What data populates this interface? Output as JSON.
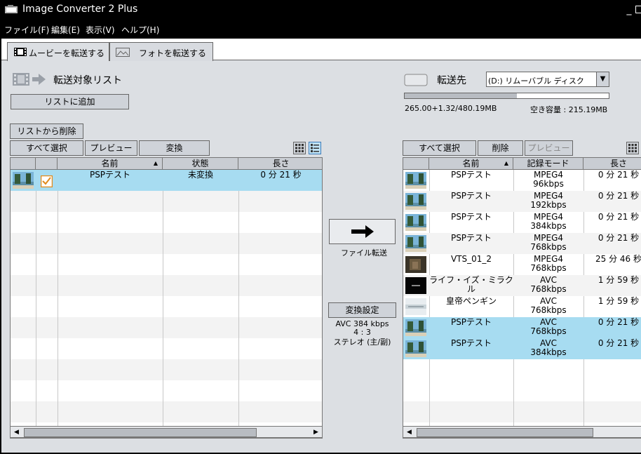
{
  "window": {
    "title": "Image Converter 2 Plus",
    "minimize": "_"
  },
  "menu": [
    "ファイル(F)",
    "編集(E)",
    "表示(V)",
    "ヘルプ(H)"
  ],
  "tabs": {
    "movie": "ムービーを転送する",
    "photo": "フォトを転送する"
  },
  "left": {
    "heading": "転送対象リスト",
    "add_button": "リストに追加",
    "remove_button": "リストから削除",
    "select_all_button": "すべて選択",
    "preview_button": "プレビュー",
    "convert_button": "変換",
    "columns": {
      "name": "名前",
      "status": "状態",
      "length": "長さ"
    },
    "rows": [
      {
        "name": "PSPテスト",
        "status": "未変換",
        "length": "0 分 21 秒"
      }
    ]
  },
  "middle": {
    "transfer_label": "ファイル転送",
    "settings_button": "変換設定",
    "info": [
      "AVC 384 kbps",
      "4 : 3",
      "ステレオ (主/副)"
    ]
  },
  "right": {
    "dest_label": "転送先",
    "dest_value": "(D:) リムーバブル ディスク",
    "usage_text": "265.00+1.32/480.19MB",
    "free_text": "空き容量 : 215.19MB",
    "usage_fraction": 0.55,
    "select_all_button": "すべて選択",
    "delete_button": "削除",
    "preview_button": "プレビュー",
    "columns": {
      "name": "名前",
      "mode": "記録モード",
      "length": "長さ"
    },
    "rows": [
      {
        "name": "PSPテスト",
        "mode1": "MPEG4",
        "mode2": "96kbps",
        "length": "0 分 21 秒",
        "thumb": "beach",
        "selected": false
      },
      {
        "name": "PSPテスト",
        "mode1": "MPEG4",
        "mode2": "192kbps",
        "length": "0 分 21 秒",
        "thumb": "beach",
        "selected": false
      },
      {
        "name": "PSPテスト",
        "mode1": "MPEG4",
        "mode2": "384kbps",
        "length": "0 分 21 秒",
        "thumb": "beach",
        "selected": false
      },
      {
        "name": "PSPテスト",
        "mode1": "MPEG4",
        "mode2": "768kbps",
        "length": "0 分 21 秒",
        "thumb": "beach",
        "selected": false
      },
      {
        "name": "VTS_01_2",
        "mode1": "MPEG4",
        "mode2": "768kbps",
        "length": "25 分 46 秒",
        "thumb": "dark",
        "selected": false
      },
      {
        "name": "ライフ・イズ・ミラクル",
        "mode1": "AVC",
        "mode2": "768kbps",
        "length": "1 分 59 秒",
        "thumb": "black",
        "selected": false
      },
      {
        "name": "皇帝ペンギン",
        "mode1": "AVC",
        "mode2": "768kbps",
        "length": "1 分 59 秒",
        "thumb": "snow",
        "selected": false
      },
      {
        "name": "PSPテスト",
        "mode1": "AVC",
        "mode2": "768kbps",
        "length": "0 分 21 秒",
        "thumb": "beach",
        "selected": true
      },
      {
        "name": "PSPテスト",
        "mode1": "AVC",
        "mode2": "384kbps",
        "length": "0 分 21 秒",
        "thumb": "beach",
        "selected": true
      }
    ]
  }
}
